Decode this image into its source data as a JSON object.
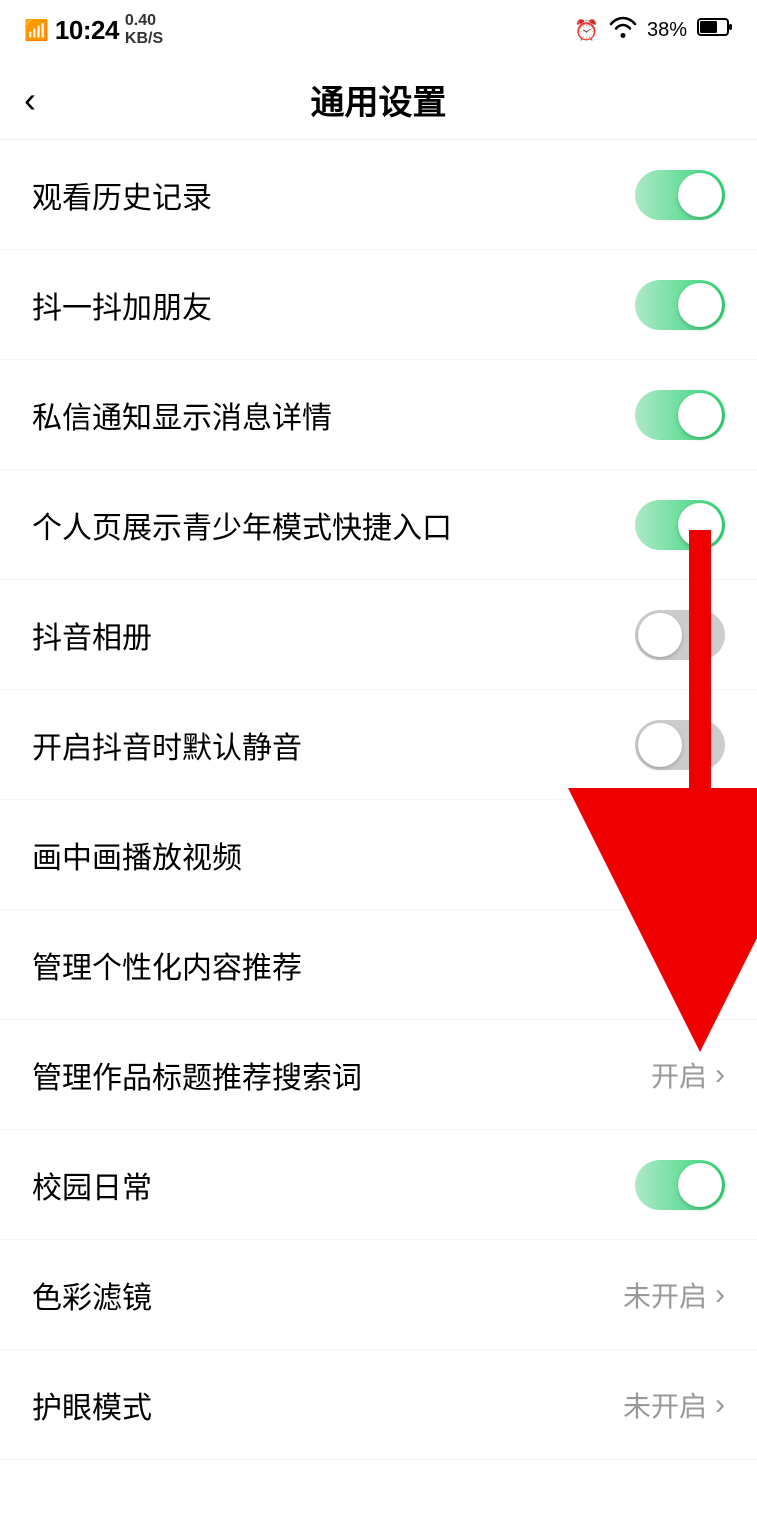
{
  "statusBar": {
    "carrier": "4GHD",
    "time": "10:24",
    "speed": "0.40",
    "speedUnit": "KB/S",
    "alarmIcon": "⏰",
    "wifiIcon": "wifi",
    "battery": "38%"
  },
  "header": {
    "backLabel": "‹",
    "title": "通用设置"
  },
  "settings": [
    {
      "id": "history",
      "label": "观看历史记录",
      "controlType": "toggle",
      "toggleState": "on"
    },
    {
      "id": "shake-add-friends",
      "label": "抖一抖加朋友",
      "controlType": "toggle",
      "toggleState": "on"
    },
    {
      "id": "dm-notification",
      "label": "私信通知显示消息详情",
      "controlType": "toggle",
      "toggleState": "on"
    },
    {
      "id": "youth-mode",
      "label": "个人页展示青少年模式快捷入口",
      "controlType": "toggle",
      "toggleState": "on"
    },
    {
      "id": "album",
      "label": "抖音相册",
      "controlType": "toggle",
      "toggleState": "off"
    },
    {
      "id": "mute",
      "label": "开启抖音时默认静音",
      "controlType": "toggle",
      "toggleState": "off"
    },
    {
      "id": "pip",
      "label": "画中画播放视频",
      "controlType": "arrow",
      "statusText": ""
    },
    {
      "id": "personalized",
      "label": "管理个性化内容推荐",
      "controlType": "arrow",
      "statusText": ""
    },
    {
      "id": "search-suggest",
      "label": "管理作品标题推荐搜索词",
      "controlType": "arrow-with-status",
      "statusText": "开启"
    },
    {
      "id": "campus",
      "label": "校园日常",
      "controlType": "toggle",
      "toggleState": "on"
    },
    {
      "id": "color-filter",
      "label": "色彩滤镜",
      "controlType": "arrow-with-status",
      "statusText": "未开启"
    },
    {
      "id": "eye-care",
      "label": "护眼模式",
      "controlType": "arrow-with-status",
      "statusText": "未开启"
    }
  ]
}
